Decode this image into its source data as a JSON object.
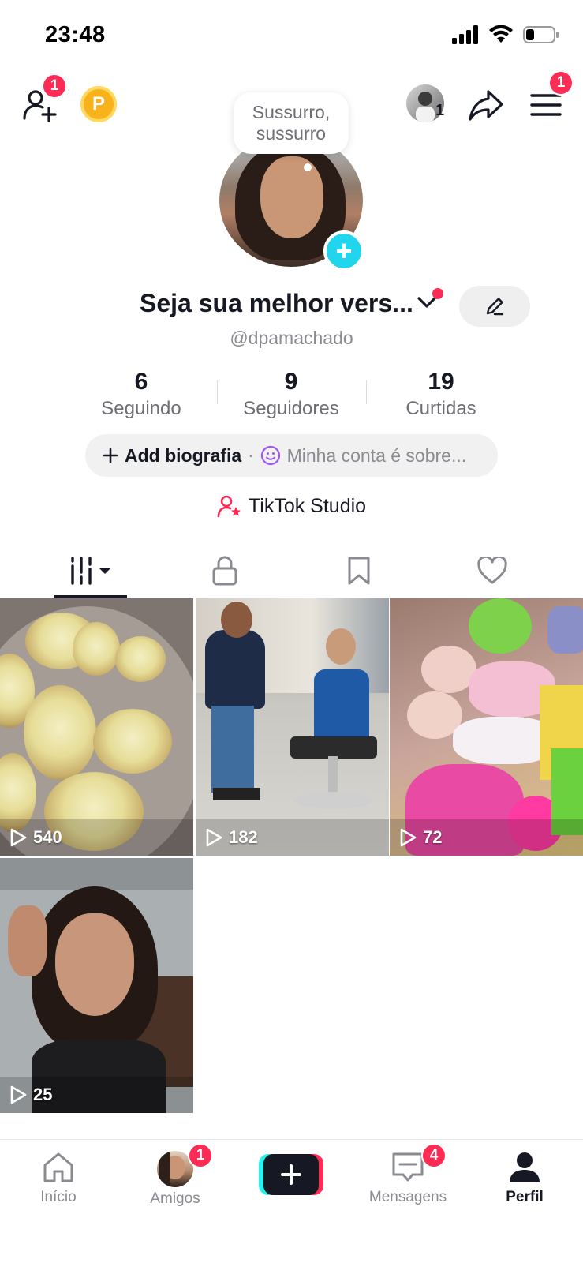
{
  "status_bar": {
    "time": "23:48",
    "icons": [
      "cellular-signal-icon",
      "wifi-icon",
      "battery-low-icon"
    ]
  },
  "top_bar": {
    "add_friends_badge": "1",
    "coin_letter": "P",
    "story_avatar_count": "1",
    "menu_badge": "1"
  },
  "profile": {
    "bubble_text_line1": "Sussurro,",
    "bubble_text_line2": "sussurro",
    "display_name": "Seja sua melhor vers...",
    "username": "@dpamachado",
    "stats": [
      {
        "value": "6",
        "label": "Seguindo"
      },
      {
        "value": "9",
        "label": "Seguidores"
      },
      {
        "value": "19",
        "label": "Curtidas"
      }
    ],
    "bio": {
      "add_label": "Add biografia",
      "separator": "·",
      "hint": "Minha conta é sobre..."
    },
    "studio_label": "TikTok Studio"
  },
  "tabs": [
    {
      "name": "videos",
      "icon": "grid-bars-icon",
      "active": true
    },
    {
      "name": "private",
      "icon": "lock-icon",
      "active": false
    },
    {
      "name": "saved",
      "icon": "bookmark-icon",
      "active": false
    },
    {
      "name": "liked",
      "icon": "heart-icon",
      "active": false
    }
  ],
  "videos": [
    {
      "views": "540"
    },
    {
      "views": "182"
    },
    {
      "views": "72"
    },
    {
      "views": "25"
    }
  ],
  "bottom_nav": {
    "items": [
      {
        "label": "Início",
        "icon": "home-icon",
        "active": false
      },
      {
        "label": "Amigos",
        "icon": "friends-avatar-icon",
        "badge": "1",
        "active": false
      },
      {
        "label": "",
        "icon": "create-plus-icon",
        "active": false
      },
      {
        "label": "Mensagens",
        "icon": "inbox-icon",
        "badge": "4",
        "active": false
      },
      {
        "label": "Perfil",
        "icon": "profile-icon",
        "active": true
      }
    ]
  },
  "colors": {
    "accent_red": "#fe2c55",
    "accent_cyan": "#25f4ee",
    "text_primary": "#161823",
    "text_secondary": "#8a8b91"
  }
}
